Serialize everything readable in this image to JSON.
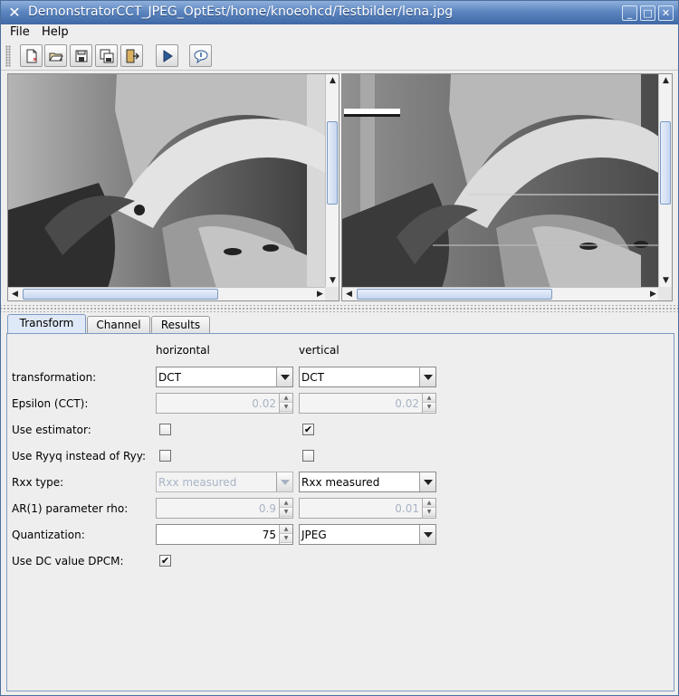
{
  "window": {
    "title": "DemonstratorCCT_JPEG_OptEst/home/knoeohcd/Testbilder/lena.jpg",
    "app_icon": "x-window-icon"
  },
  "menubar": {
    "file": "File",
    "help": "Help"
  },
  "toolbar": {
    "buttons": [
      "new-document-icon",
      "open-icon",
      "save-icon",
      "save-all-icon",
      "exit-icon",
      "run-icon",
      "info-balloon-icon"
    ]
  },
  "tabs": [
    {
      "label": "Transform",
      "selected": true
    },
    {
      "label": "Channel",
      "selected": false
    },
    {
      "label": "Results",
      "selected": false
    }
  ],
  "form": {
    "col_horizontal": "horizontal",
    "col_vertical": "vertical",
    "rows": {
      "transformation": {
        "label": "transformation:",
        "h": "DCT",
        "v": "DCT"
      },
      "epsilon": {
        "label": "Epsilon (CCT):",
        "h": "0.02",
        "v": "0.02"
      },
      "estimator": {
        "label": "Use estimator:",
        "h": false,
        "v": true
      },
      "ryyq": {
        "label": "Use Ryyq instead of Ryy:",
        "h": false,
        "v": false
      },
      "rxx": {
        "label": "Rxx type:",
        "h": "Rxx measured",
        "v": "Rxx measured"
      },
      "rho": {
        "label": "AR(1) parameter rho:",
        "h": "0.9",
        "v": "0.01"
      },
      "quant": {
        "label": "Quantization:",
        "h": "75",
        "v": "JPEG"
      },
      "dpcm": {
        "label": "Use DC value DPCM:",
        "h": true
      }
    }
  },
  "checkmark": "✔",
  "colors": {
    "titlebar": "#5d86c0",
    "selected_tab": "#dfe8f6",
    "disabled_text": "#a9b4c6"
  }
}
